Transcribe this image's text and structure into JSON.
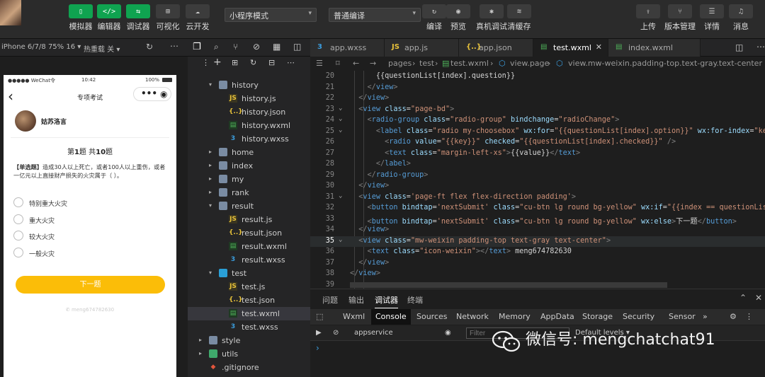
{
  "toolbar": {
    "buttons": [
      {
        "label": "模拟器",
        "glyph": "▯"
      },
      {
        "label": "编辑器",
        "glyph": "</>"
      },
      {
        "label": "调试器",
        "glyph": "⇆"
      },
      {
        "label": "可视化",
        "glyph": "⊞"
      },
      {
        "label": "云开发",
        "glyph": "☁"
      }
    ],
    "mode_select": "小程序模式",
    "compile_select": "普通编译",
    "actions": [
      {
        "label": "编译",
        "glyph": "↻"
      },
      {
        "label": "预览",
        "glyph": "◉"
      },
      {
        "label": "真机调试",
        "glyph": "✱"
      },
      {
        "label": "清缓存",
        "glyph": "≋"
      }
    ],
    "right_actions": [
      {
        "label": "上传",
        "glyph": "⇪"
      },
      {
        "label": "版本管理",
        "glyph": "⑂"
      },
      {
        "label": "详情",
        "glyph": "☰"
      },
      {
        "label": "消息",
        "glyph": "♫"
      }
    ]
  },
  "simulator": {
    "device": "iPhone 6/7/8 75% 16 ▾",
    "hot_reload": "热重载 关 ▾",
    "status_left": "●●●●● WeChat令",
    "status_time": "10:42",
    "status_right": "100%",
    "nav_title": "专项考试",
    "back": "‹",
    "user_name": "姑苏洛言",
    "progress_prefix": "第",
    "progress_current": "1",
    "progress_mid": "题 共",
    "progress_total": "10",
    "progress_suffix": "题",
    "question_tag": "【单选题】",
    "question_text": "造成30人以上死亡，或者100人以上重伤，或者一亿元以上直接财产损失的火灾属于（ ）。",
    "options": [
      "特别重大火灾",
      "重大火灾",
      "较大火灾",
      "一般火灾"
    ],
    "next_button": "下一题",
    "footer": "meng674782630"
  },
  "explorer": {
    "items": [
      {
        "name": "history",
        "type": "folder-open",
        "depth": 1
      },
      {
        "name": "history.js",
        "type": "js",
        "depth": 2
      },
      {
        "name": "history.json",
        "type": "json",
        "depth": 2
      },
      {
        "name": "history.wxml",
        "type": "wxml",
        "depth": 2
      },
      {
        "name": "history.wxss",
        "type": "wxss",
        "depth": 2
      },
      {
        "name": "home",
        "type": "folder",
        "depth": 1
      },
      {
        "name": "index",
        "type": "folder",
        "depth": 1
      },
      {
        "name": "my",
        "type": "folder",
        "depth": 1
      },
      {
        "name": "rank",
        "type": "folder",
        "depth": 1
      },
      {
        "name": "result",
        "type": "folder-open",
        "depth": 1
      },
      {
        "name": "result.js",
        "type": "js",
        "depth": 2
      },
      {
        "name": "result.json",
        "type": "json",
        "depth": 2
      },
      {
        "name": "result.wxml",
        "type": "wxml",
        "depth": 2
      },
      {
        "name": "result.wxss",
        "type": "wxss",
        "depth": 2
      },
      {
        "name": "test",
        "type": "folder-open-b",
        "depth": 1
      },
      {
        "name": "test.js",
        "type": "js",
        "depth": 2
      },
      {
        "name": "test.json",
        "type": "json",
        "depth": 2
      },
      {
        "name": "test.wxml",
        "type": "wxml",
        "depth": 2,
        "selected": true
      },
      {
        "name": "test.wxss",
        "type": "wxss",
        "depth": 2
      },
      {
        "name": "style",
        "type": "folder",
        "depth": 0
      },
      {
        "name": "utils",
        "type": "folder-g",
        "depth": 0
      },
      {
        "name": ".gitignore",
        "type": "git",
        "depth": 0
      }
    ]
  },
  "tabs": [
    {
      "name": "app.wxss",
      "icon": "3",
      "color": "#3b9ddd"
    },
    {
      "name": "app.js",
      "icon": "JS",
      "color": "#e8c23a"
    },
    {
      "name": "app.json",
      "icon": "{..}",
      "color": "#e8c23a"
    },
    {
      "name": "test.wxml",
      "icon": "▤",
      "color": "#4fb35a",
      "active": true,
      "close": "✕"
    },
    {
      "name": "index.wxml",
      "icon": "▤",
      "color": "#4fb35a"
    }
  ],
  "breadcrumb": [
    "pages",
    "test",
    "test.wxml",
    "view.page",
    "view.mw-weixin.padding-top.text-gray.text-center"
  ],
  "code": [
    {
      "n": "20",
      "html": "      <span class=\"w\">{{questionList[index].question}}</span>"
    },
    {
      "n": "21",
      "html": "    <span class=\"p\">&lt;/</span><span class=\"t\">view</span><span class=\"p\">&gt;</span>"
    },
    {
      "n": "22",
      "html": "  <span class=\"p\">&lt;/</span><span class=\"t\">view</span><span class=\"p\">&gt;</span>"
    },
    {
      "n": "23",
      "fold": true,
      "html": "  <span class=\"p\">&lt;</span><span class=\"t\">view</span> <span class=\"a\">class</span>=<span class=\"s\">\"page-bd\"</span><span class=\"p\">&gt;</span>"
    },
    {
      "n": "24",
      "fold": true,
      "html": "    <span class=\"p\">&lt;</span><span class=\"t\">radio-group</span> <span class=\"a\">class</span>=<span class=\"s\">\"radio-group\"</span> <span class=\"a\">bindchange</span>=<span class=\"s\">\"radioChange\"</span><span class=\"p\">&gt;</span>"
    },
    {
      "n": "25",
      "fold": true,
      "html": "      <span class=\"p\">&lt;</span><span class=\"t\">label</span> <span class=\"a\">class</span>=<span class=\"s\">\"radio my-choosebox\"</span> <span class=\"a\">wx:for</span>=<span class=\"s\">\"{{questionList[index].option}}\"</span> <span class=\"a\">wx:for-index</span>=<span class=\"s\">\"key\"</span>  <span class=\"a\">wx:</span>"
    },
    {
      "n": "26",
      "html": "        <span class=\"p\">&lt;</span><span class=\"t\">radio</span> <span class=\"a\">value</span>=<span class=\"s\">\"{{key}}\"</span> <span class=\"a\">checked</span>=<span class=\"s\">\"{{questionList[index].checked}}\"</span> <span class=\"p\">/&gt;</span>"
    },
    {
      "n": "27",
      "html": "        <span class=\"p\">&lt;</span><span class=\"t\">text</span> <span class=\"a\">class</span>=<span class=\"s\">\"margin-left-xs\"</span><span class=\"p\">&gt;</span>{{value}}<span class=\"p\">&lt;/</span><span class=\"t\">text</span><span class=\"p\">&gt;</span>"
    },
    {
      "n": "28",
      "html": "      <span class=\"p\">&lt;/</span><span class=\"t\">label</span><span class=\"p\">&gt;</span>"
    },
    {
      "n": "29",
      "html": "    <span class=\"p\">&lt;/</span><span class=\"t\">radio-group</span><span class=\"p\">&gt;</span>"
    },
    {
      "n": "30",
      "html": "  <span class=\"p\">&lt;/</span><span class=\"t\">view</span><span class=\"p\">&gt;</span>"
    },
    {
      "n": "31",
      "fold": true,
      "html": "  <span class=\"p\">&lt;</span><span class=\"t\">view</span> <span class=\"a\">class</span>=<span class=\"s\">'page-ft flex flex-direction padding'</span><span class=\"p\">&gt;</span>"
    },
    {
      "n": "32",
      "html": "    <span class=\"p\">&lt;</span><span class=\"t\">button</span> <span class=\"a\">bindtap</span>=<span class=\"s\">'nextSubmit'</span> <span class=\"a\">class</span>=<span class=\"s\">\"cu-btn lg round bg-yellow\"</span> <span class=\"a\">wx:if</span>=<span class=\"s\">\"{{index == questionList.length</span>"
    },
    {
      "n": "33",
      "html": "    <span class=\"p\">&lt;</span><span class=\"t\">button</span> <span class=\"a\">bindtap</span>=<span class=\"s\">'nextSubmit'</span> <span class=\"a\">class</span>=<span class=\"s\">\"cu-btn lg round bg-yellow\"</span> <span class=\"a\">wx:else</span><span class=\"p\">&gt;</span>下一题<span class=\"p\">&lt;/</span><span class=\"t\">button</span><span class=\"p\">&gt;</span>"
    },
    {
      "n": "34",
      "html": "  <span class=\"p\">&lt;/</span><span class=\"t\">view</span><span class=\"p\">&gt;</span>"
    },
    {
      "n": "35",
      "fold": true,
      "cur": true,
      "html": "  <span class=\"p\">&lt;</span><span class=\"t\">view</span> <span class=\"a\">class</span>=<span class=\"s\">\"mw-weixin padding-top text-gray text-center\"</span><span class=\"p\">&gt;</span>"
    },
    {
      "n": "36",
      "html": "    <span class=\"p\">&lt;</span><span class=\"t\">text</span> <span class=\"a\">class</span>=<span class=\"s\">\"icon-weixin\"</span><span class=\"p\">&gt;&lt;/</span><span class=\"t\">text</span><span class=\"p\">&gt;</span> meng674782630"
    },
    {
      "n": "37",
      "html": "  <span class=\"p\">&lt;/</span><span class=\"t\">view</span><span class=\"p\">&gt;</span>"
    },
    {
      "n": "38",
      "html": "<span class=\"p\">&lt;/</span><span class=\"t\">view</span><span class=\"p\">&gt;</span>"
    },
    {
      "n": "39",
      "html": ""
    }
  ],
  "panel": {
    "tabs": [
      "问题",
      "输出",
      "调试器",
      "终端"
    ],
    "dev_tabs": [
      "Wxml",
      "Console",
      "Sources",
      "Network",
      "Memory",
      "AppData",
      "Storage",
      "Security",
      "Sensor",
      "»"
    ],
    "context": "appservice",
    "filter_placeholder": "Filter",
    "levels": "Default levels ▾",
    "prompt": "›"
  },
  "watermark": "微信号: mengchatchat91",
  "colors": {
    "green": "#0fa350",
    "yellow": "#fbbd08",
    "bg": "#1e1e1e"
  }
}
